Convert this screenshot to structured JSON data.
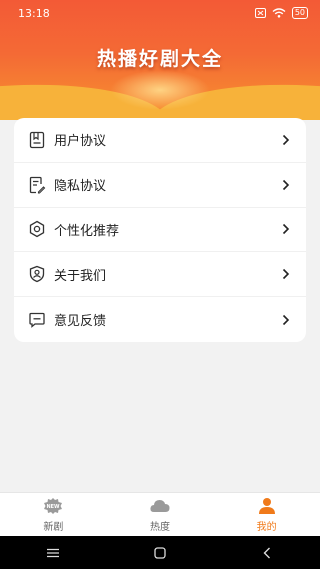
{
  "status_bar": {
    "time": "13:18",
    "battery": "50"
  },
  "banner": {
    "title": "热播好剧大全"
  },
  "menu": [
    {
      "label": "用户协议",
      "icon": "document-icon"
    },
    {
      "label": "隐私协议",
      "icon": "edit-document-icon"
    },
    {
      "label": "个性化推荐",
      "icon": "settings-icon"
    },
    {
      "label": "关于我们",
      "icon": "user-shield-icon"
    },
    {
      "label": "意见反馈",
      "icon": "message-icon"
    }
  ],
  "tabs": [
    {
      "label": "新剧",
      "icon": "new-badge-icon",
      "active": false
    },
    {
      "label": "热度",
      "icon": "cloud-icon",
      "active": false
    },
    {
      "label": "我的",
      "icon": "person-icon",
      "active": true
    }
  ],
  "colors": {
    "accent": "#f07a1a",
    "header_top": "#f35a36",
    "header_bottom": "#f7932f"
  }
}
